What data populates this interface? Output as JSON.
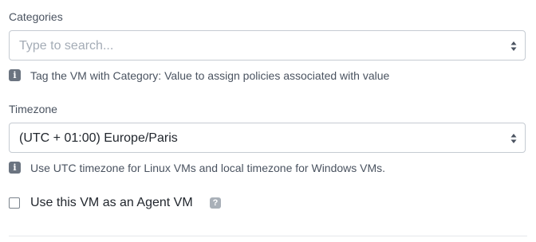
{
  "categories": {
    "label": "Categories",
    "placeholder": "Type to search...",
    "help_icon": "info-icon",
    "help_text": "Tag the VM with Category: Value to assign policies associated with value"
  },
  "timezone": {
    "label": "Timezone",
    "value": "(UTC + 01:00) Europe/Paris",
    "help_icon": "info-icon",
    "help_text": "Use UTC timezone for Linux VMs and local timezone for Windows VMs."
  },
  "agent_vm": {
    "label": "Use this VM as an Agent VM",
    "checked": false,
    "help_icon": "question-icon",
    "help_glyph": "?"
  },
  "colors": {
    "border": "#c5cbd2",
    "placeholder": "#a4acb6",
    "muted_text": "#4a5360",
    "info_icon_bg": "#6b7480",
    "question_icon_bg": "#a9b0b8"
  }
}
